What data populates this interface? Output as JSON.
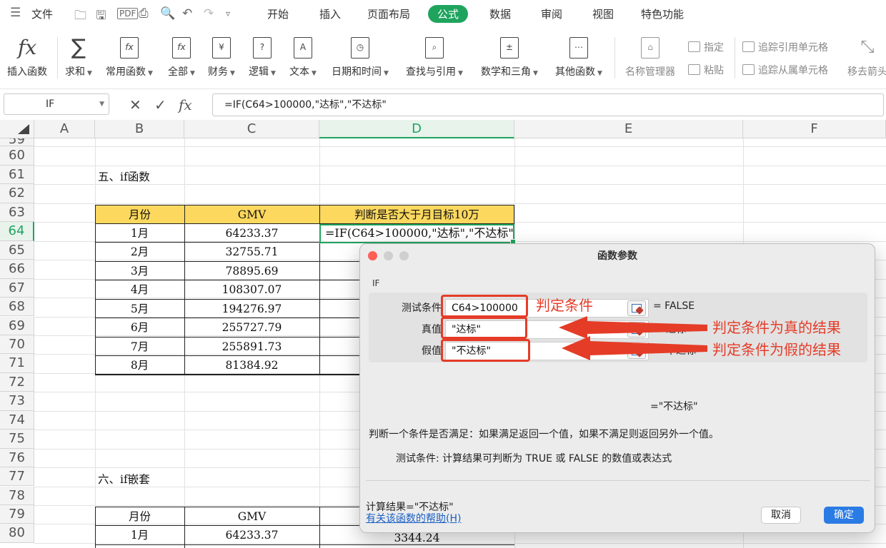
{
  "menubar": {
    "file": "文件",
    "tabs": [
      "开始",
      "插入",
      "页面布局",
      "公式",
      "数据",
      "审阅",
      "视图",
      "特色功能"
    ],
    "active_tab": "公式"
  },
  "ribbon": {
    "insert_function": "插入函数",
    "autosum": "求和",
    "common": "常用函数",
    "all": "全部",
    "finance": "财务",
    "logic": "逻辑",
    "text": "文本",
    "datetime": "日期和时间",
    "lookup": "查找与引用",
    "math": "数学和三角",
    "other": "其他函数",
    "name_manager": "名称管理器",
    "define": "指定",
    "paste": "粘贴",
    "trace_precedents": "追踪引用单元格",
    "trace_dependents": "追踪从属单元格",
    "remove_arrows": "移去箭头",
    "icon_finance": "¥",
    "icon_logic": "?",
    "icon_text": "A"
  },
  "formula_bar": {
    "name_box": "IF",
    "cancel": "✕",
    "confirm": "✓",
    "fx": "fx",
    "formula": "=IF(C64>100000,\"达标\",\"不达标\""
  },
  "columns": [
    "A",
    "B",
    "C",
    "D",
    "E",
    "F"
  ],
  "rows": [
    "59",
    "60",
    "61",
    "62",
    "63",
    "64",
    "65",
    "66",
    "67",
    "68",
    "69",
    "70",
    "71",
    "72",
    "73",
    "74",
    "75",
    "76",
    "77",
    "78",
    "79",
    "80"
  ],
  "section1_title": "五、if函数",
  "section2_title": "六、if嵌套",
  "table1": {
    "headers": [
      "月份",
      "GMV",
      "判断是否大于月目标10万"
    ],
    "rows": [
      [
        "1月",
        "64233.37"
      ],
      [
        "2月",
        "32755.71"
      ],
      [
        "3月",
        "78895.69"
      ],
      [
        "4月",
        "108307.07"
      ],
      [
        "5月",
        "194276.97"
      ],
      [
        "6月",
        "255727.79"
      ],
      [
        "7月",
        "255891.73"
      ],
      [
        "8月",
        "81384.92"
      ]
    ],
    "editing_formula": "=IF(C64>100000,\"达标\",\"不达标\""
  },
  "table2": {
    "headers": [
      "月份",
      "GMV"
    ],
    "rows": [
      [
        "1月",
        "64233.37",
        "3344.24"
      ]
    ]
  },
  "dialog": {
    "title": "函数参数",
    "function_name": "IF",
    "args": [
      {
        "label": "测试条件",
        "value": "C64>100000",
        "result": "= FALSE"
      },
      {
        "label": "真值",
        "value": "\"达标\"",
        "result": "=\"达标\""
      },
      {
        "label": "假值",
        "value": "\"不达标\"",
        "result": "=\"不达标\""
      }
    ],
    "value": "=\"不达标\"",
    "description": "判断一个条件是否满足：如果满足返回一个值，如果不满足则返回另外一个值。",
    "arg_description": "测试条件: 计算结果可判断为 TRUE 或 FALSE 的数值或表达式",
    "result": "计算结果=\"不达标\"",
    "help_link": "有关该函数的帮助(H)",
    "cancel": "取消",
    "ok": "确定"
  },
  "annotations": {
    "condition": "判定条件",
    "true_result": "判定条件为真的结果",
    "false_result": "判定条件为假的结果"
  },
  "colors": {
    "accent": "#1fa45e",
    "header_fill": "#fcd85e",
    "annotation": "#e53c28",
    "ok_button": "#2b7be4"
  }
}
